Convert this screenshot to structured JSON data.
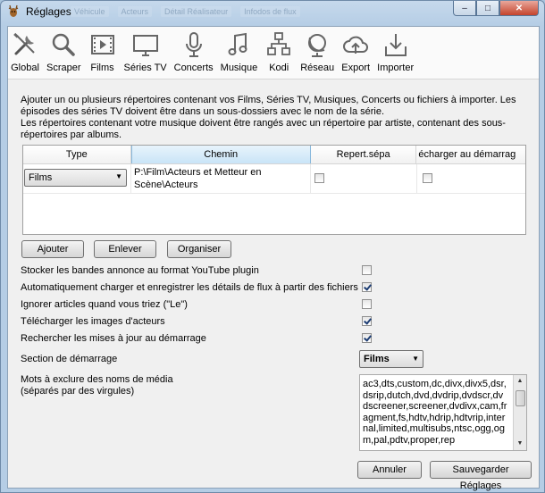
{
  "window": {
    "title": "Réglages",
    "ghost_tabs": [
      "Véhicule",
      "Acteurs",
      "Détail Réalisateur",
      "Infodos de flux"
    ]
  },
  "toolbar": {
    "items": [
      {
        "id": "global",
        "label": "Global",
        "icon": "tools-icon"
      },
      {
        "id": "scraper",
        "label": "Scraper",
        "icon": "magnifier-icon"
      },
      {
        "id": "films",
        "label": "Films",
        "icon": "film-icon"
      },
      {
        "id": "series",
        "label": "Séries TV",
        "icon": "tv-icon"
      },
      {
        "id": "concerts",
        "label": "Concerts",
        "icon": "microphone-icon"
      },
      {
        "id": "musique",
        "label": "Musique",
        "icon": "music-note-icon"
      },
      {
        "id": "kodi",
        "label": "Kodi",
        "icon": "network-boxes-icon"
      },
      {
        "id": "reseau",
        "label": "Réseau",
        "icon": "globe-icon"
      },
      {
        "id": "export",
        "label": "Export",
        "icon": "cloud-upload-icon"
      },
      {
        "id": "importer",
        "label": "Importer",
        "icon": "download-icon"
      }
    ]
  },
  "description": {
    "line1": "Ajouter un ou plusieurs répertoires contenant vos Films, Séries TV, Musiques, Concerts ou fichiers à importer. Les épisodes des séries TV doivent être dans un sous-dossiers avec le nom de la série.",
    "line2": "Les répertoires contenant votre musique doivent être rangés avec un répertoire par artiste, contenant des sous-répertoires par albums."
  },
  "table": {
    "columns": [
      "Type",
      "Chemin",
      "Repert.sépa",
      "écharger au démarrag"
    ],
    "rows": [
      {
        "type": "Films",
        "path": "P:\\Film\\Acteurs et Metteur en Scène\\Acteurs",
        "separate": false,
        "load_on_start": false
      }
    ]
  },
  "buttons": {
    "add": "Ajouter",
    "remove": "Enlever",
    "organize": "Organiser",
    "cancel": "Annuler",
    "save": "Sauvegarder Réglages"
  },
  "options": [
    {
      "label": "Stocker les bandes annonce au format YouTube plugin",
      "checked": false
    },
    {
      "label": "Automatiquement charger et enregistrer les détails de flux à partir des fichiers",
      "checked": true
    },
    {
      "label": "Ignorer articles quand vous triez (\"Le\")",
      "checked": false
    },
    {
      "label": "Télécharger les images d'acteurs",
      "checked": true
    },
    {
      "label": "Rechercher les mises à jour au démarrage",
      "checked": true
    }
  ],
  "startup_section": {
    "label": "Section de démarrage",
    "value": "Films"
  },
  "exclude": {
    "label_line1": "Mots à exclure des noms de média",
    "label_line2": "(séparés par des virgules)",
    "value": "ac3,dts,custom,dc,divx,divx5,dsr,dsrip,dutch,dvd,dvdrip,dvdscr,dvdscreener,screener,dvdivx,cam,fragment,fs,hdtv,hdrip,hdtvrip,internal,limited,multisubs,ntsc,ogg,ogm,pal,pdtv,proper,rep"
  },
  "colors": {
    "accent_header": "#c9e4f7",
    "window_frame": "#b5cde5",
    "check": "#1d3d73"
  }
}
